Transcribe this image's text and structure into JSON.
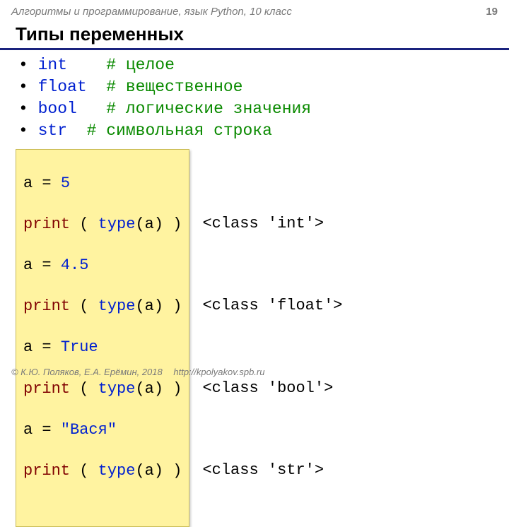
{
  "header": {
    "course": "Алгоритмы и программирование, язык Python, 10 класс",
    "page": "19"
  },
  "title": "Типы переменных",
  "bullets": {
    "b1_type": "int",
    "b1_pad": "    ",
    "b1_hash": "# ",
    "b1_desc": "целое",
    "b2_type": "float",
    "b2_pad": "  ",
    "b2_hash": "# ",
    "b2_desc": "вещественное",
    "b3_type": "bool",
    "b3_pad": "   ",
    "b3_hash": "# ",
    "b3_desc": "логические значения",
    "b4_type": "str",
    "b4_pad": "  ",
    "b4_hash": "# ",
    "b4_desc": "символьная строка"
  },
  "code": {
    "l1a": "a = ",
    "l1b": "5",
    "l2a": "print",
    "l2b": " ( ",
    "l2c": "type",
    "l2d": "(a) )",
    "l3a": "a = ",
    "l3b": "4.5",
    "l4a": "print",
    "l4b": " ( ",
    "l4c": "type",
    "l4d": "(a) )",
    "l5a": "a = ",
    "l5b": "True",
    "l6a": "print",
    "l6b": " ( ",
    "l6c": "type",
    "l6d": "(a) )",
    "l7a": "a = ",
    "l7b": "\"Вася\"",
    "l8a": "print",
    "l8b": " ( ",
    "l8c": "type",
    "l8d": "(a) )"
  },
  "output": {
    "blank": " ",
    "o1": "<class 'int'>",
    "o2": "<class 'float'>",
    "o3": "<class 'bool'>",
    "o4": "<class 'str'>"
  },
  "footer": {
    "copyright": "© К.Ю. Поляков, Е.А. Ерёмин, 2018",
    "url": "http://kpolyakov.spb.ru"
  }
}
